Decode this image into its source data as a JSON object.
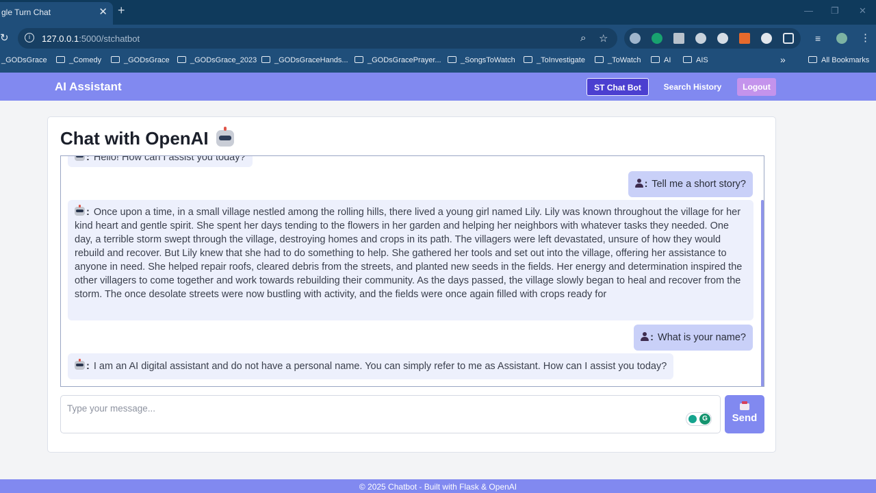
{
  "browser": {
    "tab_title": "gle Turn Chat",
    "tab_close": "✕",
    "new_tab": "+",
    "url_host": "127.0.0.1",
    "url_path": ":5000/stchatbot",
    "bookmarks": [
      "_GODsGrace",
      "_Comedy",
      "_GODsGrace",
      "_GODsGrace_2023",
      "_GODsGraceHands...",
      "_GODsGracePrayer...",
      "_SongsToWatch",
      "_ToInvestigate",
      "_ToWatch",
      "AI",
      "AIS"
    ],
    "overflow": "»",
    "all_bookmarks": "All Bookmarks"
  },
  "nav": {
    "brand": "AI Assistant",
    "items": [
      "ST Chat Bot",
      "Search History",
      "Logout"
    ]
  },
  "chat": {
    "title": "Chat with OpenAI",
    "sender_sep": ":",
    "messages": [
      {
        "role": "bot",
        "text": "Hello! How can I assist you today?"
      },
      {
        "role": "user",
        "text": "Tell me a short story?"
      },
      {
        "role": "bot",
        "text": "Once upon a time, in a small village nestled among the rolling hills, there lived a young girl named Lily. Lily was known throughout the village for her kind heart and gentle spirit. She spent her days tending to the flowers in her garden and helping her neighbors with whatever tasks they needed. One day, a terrible storm swept through the village, destroying homes and crops in its path. The villagers were left devastated, unsure of how they would rebuild and recover. But Lily knew that she had to do something to help. She gathered her tools and set out into the village, offering her assistance to anyone in need. She helped repair roofs, cleared debris from the streets, and planted new seeds in the fields. Her energy and determination inspired the other villagers to come together and work towards rebuilding their community. As the days passed, the village slowly began to heal and recover from the storm. The once desolate streets were now bustling with activity, and the fields were once again filled with crops ready for"
      },
      {
        "role": "user",
        "text": "What is your name?"
      },
      {
        "role": "bot",
        "text": "I am an AI digital assistant and do not have a personal name. You can simply refer to me as Assistant. How can I assist you today?"
      }
    ],
    "input_placeholder": "Type your message...",
    "send_label": "Send",
    "grammarly": "G"
  },
  "footer": "© 2025 Chatbot - Built with Flask & OpenAI",
  "colors": {
    "accent": "#8189f0",
    "nav_active": "#4b3fd0",
    "logout": "#c493ec",
    "user_bubble": "#c9d0f8",
    "bot_bubble": "#edf0fc"
  }
}
